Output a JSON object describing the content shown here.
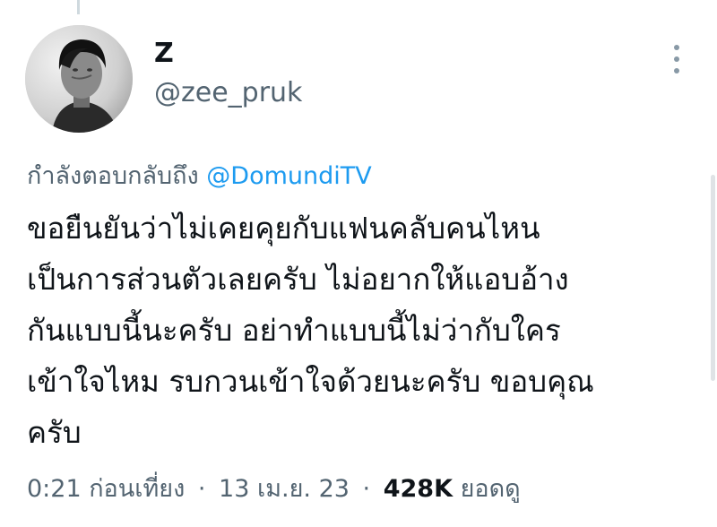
{
  "author": {
    "display_name": "Z",
    "handle": "@zee_pruk"
  },
  "reply_context": {
    "prefix": "กำลังตอบกลับถึง",
    "mention": "@DomundiTV"
  },
  "tweet": {
    "lines": [
      "ขอยืนยันว่าไม่เคยคุยกับแฟนคลับคนไหน",
      "เป็นการส่วนตัวเลยครับ ไม่อยากให้แอบอ้าง",
      "กันแบบนี้นะครับ อย่าทำแบบนี้ไม่ว่ากับใคร",
      "เข้าใจไหม รบกวนเข้าใจด้วยนะครับ ขอบคุณ",
      "ครับ"
    ]
  },
  "meta": {
    "time": "0:21 ก่อนเที่ยง",
    "separator": "·",
    "date": "13 เม.ย. 23",
    "views_count": "428K",
    "views_label": "ยอดดู"
  },
  "icons": {
    "more": "more-vertical-icon"
  },
  "colors": {
    "text_primary": "#0f1419",
    "text_secondary": "#536471",
    "link": "#1d9bf0",
    "background": "#ffffff"
  }
}
